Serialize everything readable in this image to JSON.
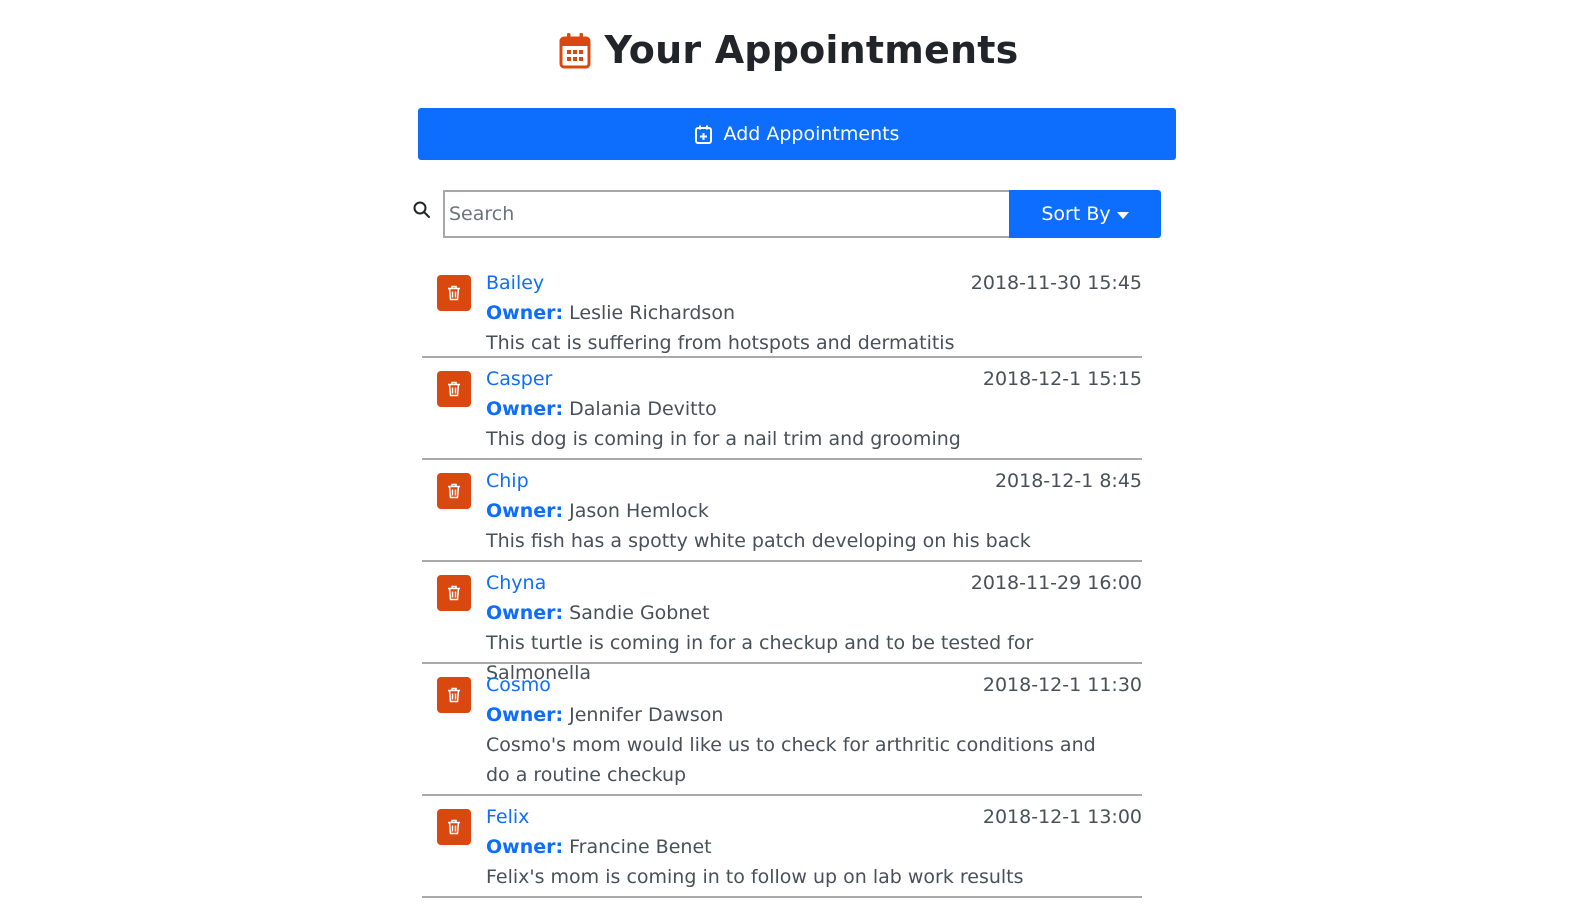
{
  "header": {
    "title": "Your Appointments",
    "icon": "calendar-icon",
    "icon_color": "#d9480f"
  },
  "add_button": {
    "label": "Add Appointments",
    "icon": "calendar-plus-icon",
    "color": "#0d6efd"
  },
  "search": {
    "placeholder": "Search",
    "icon": "search-icon"
  },
  "sort": {
    "label": "Sort By",
    "icon": "caret-down-icon",
    "color": "#0d6efd"
  },
  "owner_label": "Owner:",
  "appointments": [
    {
      "pet": "Bailey",
      "owner": "Leslie Richardson",
      "date": "2018-11-30 15:45",
      "notes": "This cat is suffering from hotspots and dermatitis"
    },
    {
      "pet": "Casper",
      "owner": "Dalania Devitto",
      "date": "2018-12-1 15:15",
      "notes": "This dog is coming in for a nail trim and grooming"
    },
    {
      "pet": "Chip",
      "owner": "Jason Hemlock",
      "date": "2018-12-1 8:45",
      "notes": "This fish has a spotty white patch developing on his back"
    },
    {
      "pet": "Chyna",
      "owner": "Sandie Gobnet",
      "date": "2018-11-29 16:00",
      "notes": "This turtle is coming in for a checkup and to be tested for Salmonella"
    },
    {
      "pet": "Cosmo",
      "owner": "Jennifer Dawson",
      "date": "2018-12-1 11:30",
      "notes": "Cosmo's mom would like us to check for arthritic conditions and do a routine checkup"
    },
    {
      "pet": "Felix",
      "owner": "Francine Benet",
      "date": "2018-12-1 13:00",
      "notes": "Felix's mom is coming in to follow up on lab work results"
    }
  ],
  "delete_icon": "trash-icon",
  "delete_color": "#d9480f"
}
